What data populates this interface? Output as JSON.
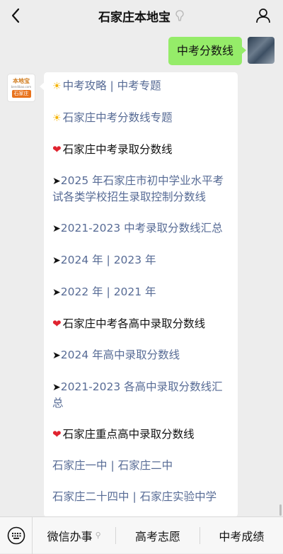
{
  "header": {
    "title": "石家庄本地宝",
    "back_icon": "chevron-left-icon",
    "verified_icon": "official-account-icon",
    "profile_icon": "person-icon"
  },
  "user_message": {
    "text": "中考分数线"
  },
  "bot_avatar": {
    "logo_text": "本地宝",
    "sub_text": "bendibao.com",
    "city": "石家庄"
  },
  "bot_message": {
    "lines": [
      {
        "prefix": "☀",
        "parts": [
          "中考攻略",
          " | ",
          "中考专题"
        ],
        "kind": "link"
      },
      {
        "prefix": "☀",
        "parts": [
          "石家庄中考分数线专题"
        ],
        "kind": "link"
      },
      {
        "prefix": "❤",
        "parts": [
          "石家庄中考录取分数线"
        ],
        "kind": "heading"
      },
      {
        "prefix": "➤",
        "parts": [
          "2025 年石家庄市初中学业水平考试各类学校招生录取控制分数线"
        ],
        "kind": "link"
      },
      {
        "prefix": "➤",
        "parts": [
          "2021-2023 中考录取分数线汇总"
        ],
        "kind": "link"
      },
      {
        "prefix": "➤",
        "parts": [
          "2024 年",
          " | ",
          "2023 年"
        ],
        "kind": "link"
      },
      {
        "prefix": "➤",
        "parts": [
          "2022 年",
          " | ",
          "2021 年"
        ],
        "kind": "link"
      },
      {
        "prefix": "❤",
        "parts": [
          "石家庄中考各高中录取分数线"
        ],
        "kind": "heading"
      },
      {
        "prefix": "➤",
        "parts": [
          "2024 年高中录取分数线"
        ],
        "kind": "link"
      },
      {
        "prefix": "➤",
        "parts": [
          "2021-2023 各高中录取分数线汇总"
        ],
        "kind": "link"
      },
      {
        "prefix": "❤",
        "parts": [
          "石家庄重点高中录取分数线"
        ],
        "kind": "heading"
      },
      {
        "prefix": "",
        "parts": [
          "石家庄一中",
          " | ",
          "石家庄二中"
        ],
        "kind": "link"
      },
      {
        "prefix": "",
        "parts": [
          "石家庄二十四中",
          " | ",
          "石家庄实验中学"
        ],
        "kind": "link"
      }
    ]
  },
  "bottom_menu": {
    "keyboard_icon": "keyboard-icon",
    "items": [
      {
        "label": "微信办事",
        "icon": "mini-program-icon"
      },
      {
        "label": "高考志愿",
        "icon": ""
      },
      {
        "label": "中考成绩",
        "icon": ""
      }
    ]
  },
  "colors": {
    "link": "#576b95",
    "user_bubble": "#95ec69",
    "background": "#ededed",
    "heart": "#e0232f",
    "sun": "#f5b301"
  }
}
